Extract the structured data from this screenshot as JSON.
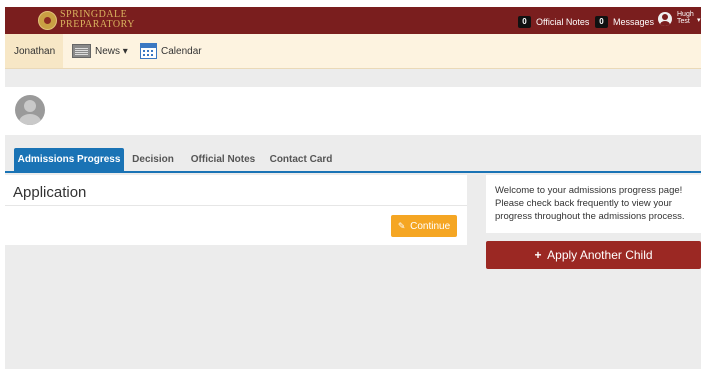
{
  "brand": {
    "line1": "SPRINGDALE",
    "line2": "PREPARATORY"
  },
  "topbar": {
    "official_notes": {
      "count": "0",
      "label": "Official Notes"
    },
    "messages": {
      "count": "0",
      "label": "Messages"
    },
    "user": {
      "first": "Hugh",
      "last": "Test"
    }
  },
  "nav": {
    "student": "Jonathan",
    "news": "News ▾",
    "calendar": "Calendar"
  },
  "tabs": [
    "Admissions Progress",
    "Decision",
    "Official Notes",
    "Contact Card"
  ],
  "main": {
    "title": "Application",
    "continue_label": "Continue",
    "continue_icon": "✎"
  },
  "side": {
    "welcome": "Welcome to your admissions progress page! Please check back frequently to view your progress throughout the admissions process.",
    "apply_label": "Apply Another Child",
    "apply_icon": "+"
  },
  "colors": {
    "topbar": "#7a1e1e",
    "tab_active": "#1a73b5",
    "continue": "#f5a623",
    "apply": "#9b2823",
    "nav_bg": "#fdf3e0"
  }
}
